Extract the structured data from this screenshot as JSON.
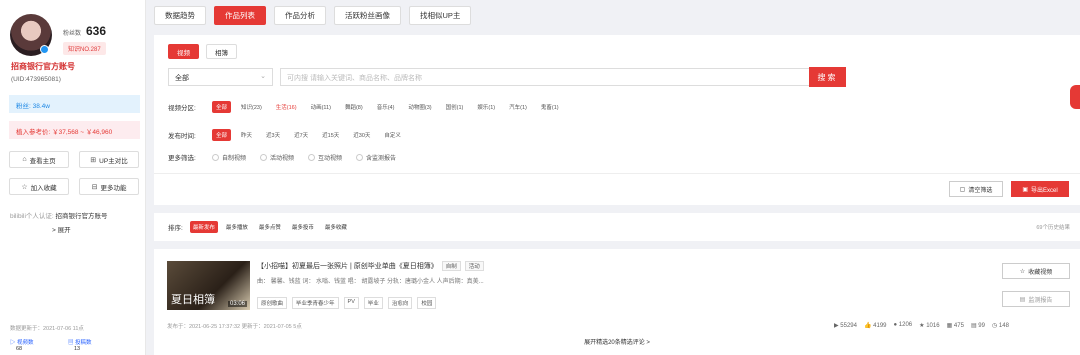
{
  "sidebar": {
    "fans_label": "粉丝数",
    "fans_count": "636",
    "rank": "知识NO.287",
    "name": "招商银行官方账号",
    "uid": "(UID:473965081)",
    "fans_box": "粉丝: 38.4w",
    "income": "植入参考价: ￥37,568 ~ ￥46,960",
    "buttons": {
      "home": "查看主页",
      "compare": "UP主对比",
      "collect": "加入收藏",
      "more": "更多功能"
    },
    "cert_label": "bilibili个人认证: ",
    "cert_value": "招商银行官方账号",
    "expand": "> 展开",
    "update": "数据更新于：2021-07-06 11点",
    "mini_stats": [
      {
        "label": "视频数",
        "value": "68"
      },
      {
        "label": "投稿数",
        "value": "13"
      }
    ]
  },
  "topnav": [
    "数据趋势",
    "作品列表",
    "作品分析",
    "活跃粉丝画像",
    "找相似UP主"
  ],
  "filter": {
    "subtabs": [
      "视频",
      "相簿"
    ],
    "select": "全部",
    "search_placeholder": "可内搜 请输入关键词、商品名称、品牌名称",
    "search_btn": "搜索",
    "zone_label": "视频分区:",
    "zones": [
      "全部",
      "知识(23)",
      "生活(16)",
      "动画(11)",
      "舞蹈(8)",
      "音乐(4)",
      "动物圈(3)",
      "国创(1)",
      "娱乐(1)",
      "汽车(1)",
      "鬼畜(1)"
    ],
    "time_label": "发布时间:",
    "times": [
      "全部",
      "昨天",
      "近3天",
      "近7天",
      "近15天",
      "近30天",
      "自定义"
    ],
    "more_label": "更多筛选:",
    "more_opts": [
      "自制视频",
      "活动视频",
      "互动视频",
      "含监测报告"
    ],
    "clear": "清空筛选",
    "export": "导出Excel"
  },
  "sort": {
    "label": "排序:",
    "opts": [
      "最新发布",
      "最多播放",
      "最多点赞",
      "最多投币",
      "最多收藏"
    ],
    "history": "69个历史结果"
  },
  "video": {
    "title": "【小招喵】初夏最后一张照片 | 原创毕业单曲《夏日相簿》",
    "tag1": "自制",
    "tag2": "活动",
    "credits": "曲：  馨馨、钱蓝 词：  水嗡、钱蓝 唱：  胡露坡子 分轨：唐璐小金人 人声后期：真美...",
    "thumb_text": "夏日相簿",
    "duration": "03:06",
    "tags": [
      "原创歌曲",
      "毕业季青春少年",
      "PV",
      "毕业",
      "治愈向",
      "校园"
    ],
    "meta": "发布于：2021-06-25 17:37:32    更新于：2021-07-05 5点",
    "collect": "收藏视频",
    "report": "监测报告",
    "stats": [
      "55294",
      "4199",
      "1206",
      "1016",
      "475",
      "99",
      "148"
    ],
    "expand_comments": "展开精选20条精选评论  >"
  },
  "colors": {
    "accent": "#e53935",
    "blue": "#1e88e5"
  }
}
